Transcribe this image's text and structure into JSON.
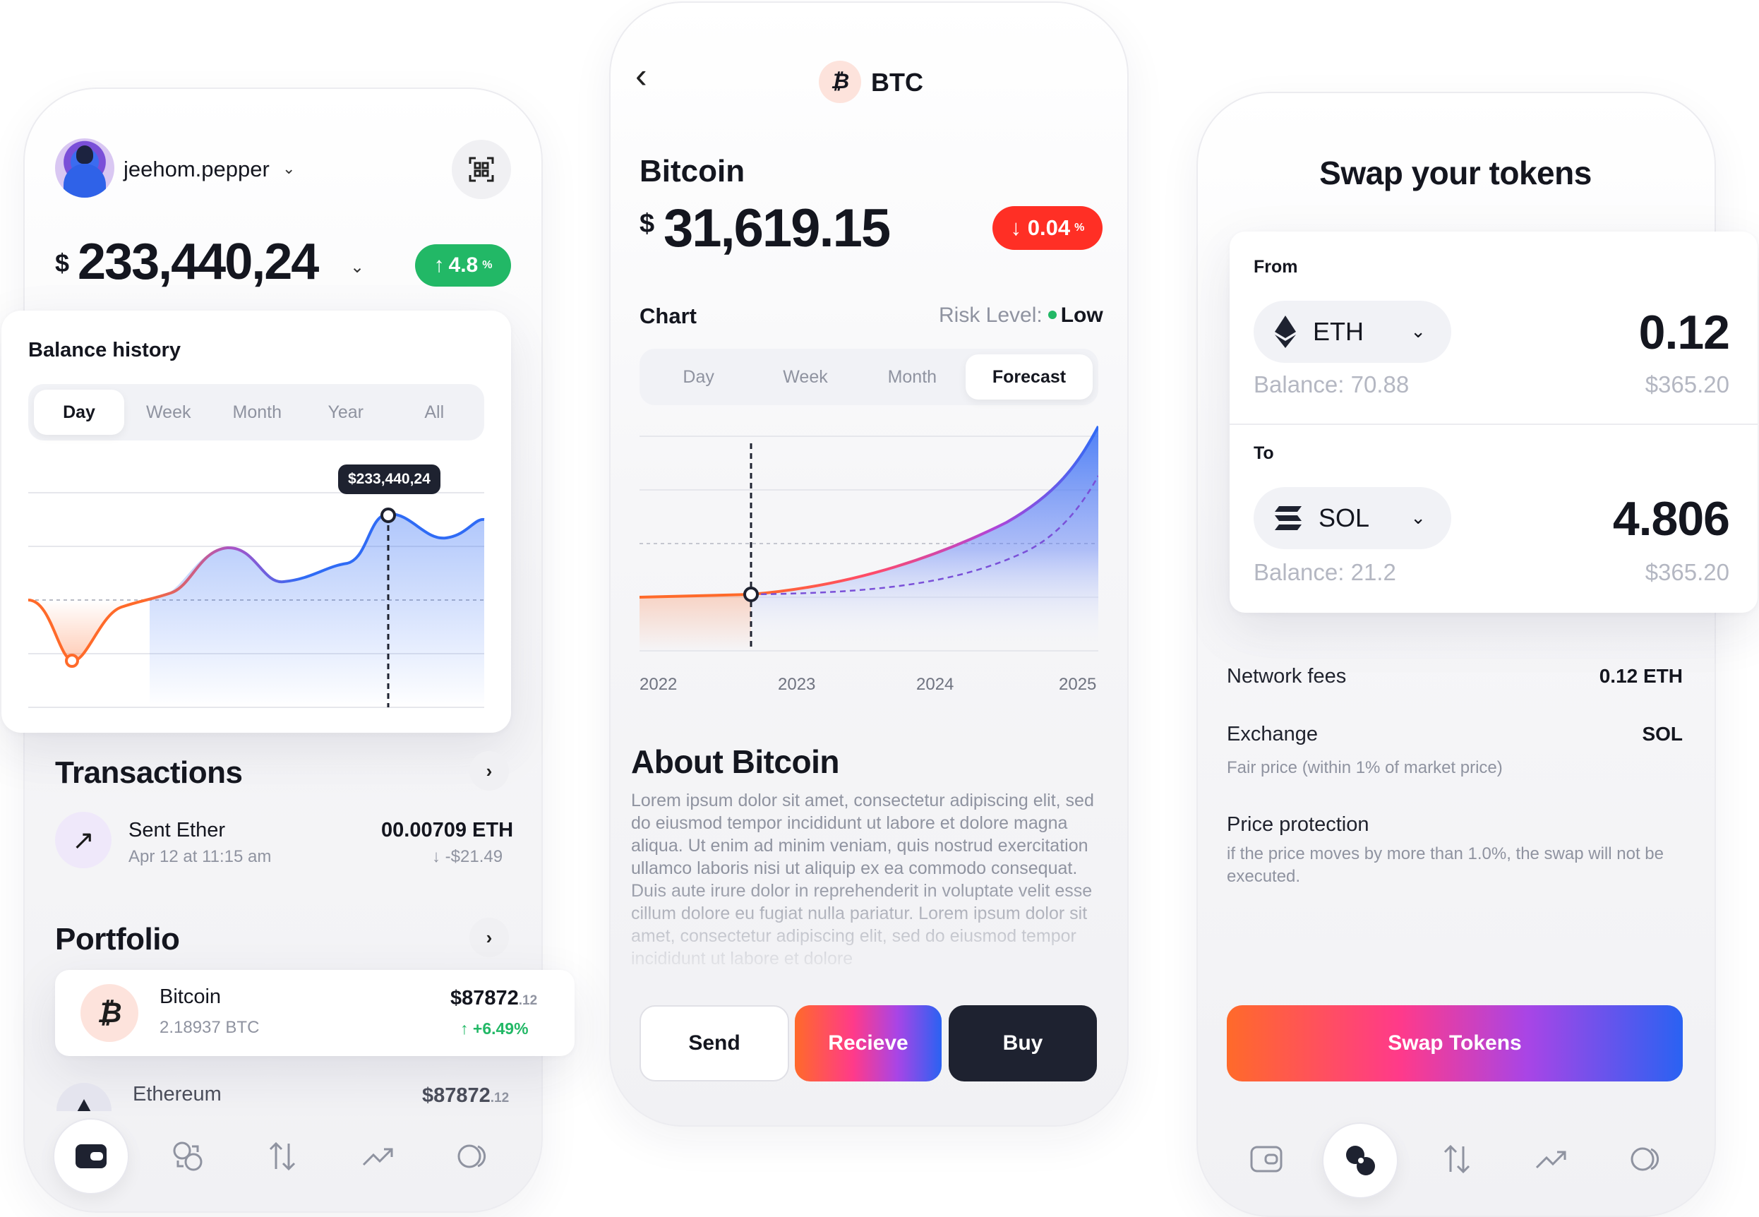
{
  "wallet": {
    "username": "jeehom.pepper",
    "balance_currency": "$",
    "balance": "233,440,24",
    "change_pct": "4.8",
    "pct_sign": "%",
    "history_title": "Balance history",
    "history_tabs": [
      "Day",
      "Week",
      "Month",
      "Year",
      "All"
    ],
    "history_active_tab": "Day",
    "tooltip": "$233,440,24",
    "transactions_title": "Transactions",
    "transactions": [
      {
        "title": "Sent Ether",
        "date": "Apr 12 at 11:15 am",
        "amount": "00.00709 ETH",
        "fiat": "↓ -$21.49"
      }
    ],
    "portfolio_title": "Portfolio",
    "portfolio": [
      {
        "name": "Bitcoin",
        "qty": "2.18937 BTC",
        "value": "$87872",
        "cents": ".12",
        "change": "↑ +6.49%"
      },
      {
        "name": "Ethereum",
        "value": "$87872",
        "cents": ".12"
      }
    ]
  },
  "coin": {
    "code": "BTC",
    "name": "Bitcoin",
    "currency": "$",
    "price": "31,619.15",
    "change_pct": "↓ 0.04",
    "pct_sign": "%",
    "chart_label": "Chart",
    "risk_label": "Risk Level:",
    "risk_value": "Low",
    "tabs": [
      "Day",
      "Week",
      "Month",
      "Forecast"
    ],
    "active_tab": "Forecast",
    "about_title": "About Bitcoin",
    "about_text": "Lorem ipsum dolor sit amet, consectetur adipiscing elit, sed do eiusmod tempor incididunt ut labore et dolore magna aliqua. Ut enim ad minim veniam, quis nostrud exercitation ullamco laboris nisi ut aliquip ex ea commodo consequat. Duis aute irure dolor in reprehenderit in voluptate velit esse cillum dolore eu fugiat nulla pariatur. Lorem ipsum dolor sit amet, consectetur adipiscing elit, sed do eiusmod tempor incididunt ut labore et dolore",
    "buttons": {
      "send": "Send",
      "receive": "Recieve",
      "buy": "Buy"
    }
  },
  "swap": {
    "title": "Swap your tokens",
    "from_label": "From",
    "from_token": "ETH",
    "from_amount": "0.12",
    "from_balance": "Balance: 70.88",
    "from_fiat": "$365.20",
    "to_label": "To",
    "to_token": "SOL",
    "to_amount": "4.806",
    "to_balance": "Balance: 21.2",
    "to_fiat": "$365.20",
    "network_fees_label": "Network fees",
    "network_fees_value": "0.12 ETH",
    "exchange_label": "Exchange",
    "exchange_value": "SOL",
    "exchange_sub": "Fair price (within 1% of market price)",
    "protection_label": "Price protection",
    "protection_sub": "if the price moves by more than 1.0%, the swap will  not be executed.",
    "button": "Swap Tokens"
  },
  "colors": {
    "green": "#22b866",
    "red": "#ff2f25",
    "dark": "#1e2230",
    "blue": "#2a62f2",
    "orange": "#ff6a2a"
  },
  "icons": {
    "wallet_nav": [
      "wallet-icon",
      "coins-icon",
      "swap-arrows-icon",
      "trend-icon",
      "toggle-icon"
    ]
  },
  "chart_data": [
    {
      "type": "area",
      "title": "Balance history",
      "series": [
        {
          "values": [
            -2,
            -18,
            8,
            40,
            26,
            82,
            88
          ]
        }
      ]
    },
    {
      "type": "line",
      "x_ticks": [
        "2022",
        "2023",
        "2024",
        "2025"
      ],
      "series": [
        {
          "values": [
            0,
            0,
            10,
            80
          ]
        },
        {
          "values": [
            0,
            0,
            7,
            50
          ]
        }
      ]
    }
  ]
}
